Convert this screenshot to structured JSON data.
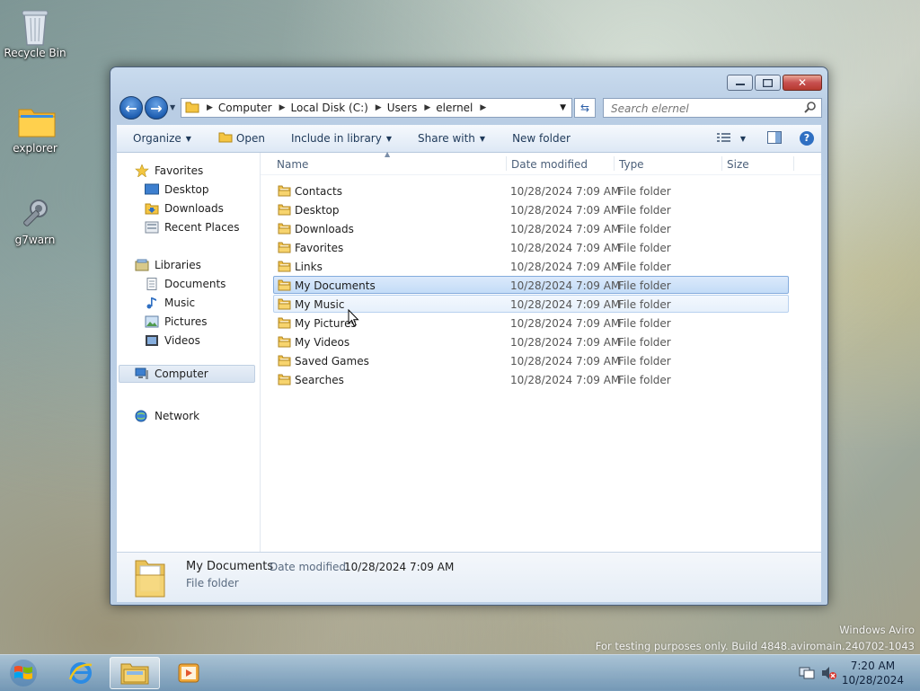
{
  "desktop": {
    "icons": [
      {
        "label": "Recycle Bin",
        "icon": "recycle-bin-icon"
      },
      {
        "label": "explorer",
        "icon": "folder-icon"
      },
      {
        "label": "g7warn",
        "icon": "gear-icon"
      }
    ],
    "watermark": {
      "line1": "Windows Aviro",
      "line2": "For testing purposes only. Build 4848.aviromain.240702-1043"
    }
  },
  "window": {
    "nav": {
      "back": "back-arrow-icon",
      "forward": "forward-arrow-icon"
    },
    "address": {
      "crumbs": [
        "Computer",
        "Local Disk (C:)",
        "Users",
        "elernel"
      ]
    },
    "search": {
      "placeholder": "Search elernel"
    },
    "toolbar": {
      "organize": "Organize",
      "open": "Open",
      "include_in_library": "Include in library",
      "share_with": "Share with",
      "new_folder": "New folder"
    },
    "sidebar": {
      "favorites": "Favorites",
      "favorites_items": [
        "Desktop",
        "Downloads",
        "Recent Places"
      ],
      "libraries": "Libraries",
      "libraries_items": [
        "Documents",
        "Music",
        "Pictures",
        "Videos"
      ],
      "computer": "Computer",
      "network": "Network"
    },
    "columns": {
      "name": "Name",
      "date": "Date modified",
      "type": "Type",
      "size": "Size"
    },
    "files": [
      {
        "name": "Contacts",
        "date": "10/28/2024 7:09 AM",
        "type": "File folder"
      },
      {
        "name": "Desktop",
        "date": "10/28/2024 7:09 AM",
        "type": "File folder"
      },
      {
        "name": "Downloads",
        "date": "10/28/2024 7:09 AM",
        "type": "File folder"
      },
      {
        "name": "Favorites",
        "date": "10/28/2024 7:09 AM",
        "type": "File folder"
      },
      {
        "name": "Links",
        "date": "10/28/2024 7:09 AM",
        "type": "File folder"
      },
      {
        "name": "My Documents",
        "date": "10/28/2024 7:09 AM",
        "type": "File folder"
      },
      {
        "name": "My Music",
        "date": "10/28/2024 7:09 AM",
        "type": "File folder"
      },
      {
        "name": "My Pictures",
        "date": "10/28/2024 7:09 AM",
        "type": "File folder"
      },
      {
        "name": "My Videos",
        "date": "10/28/2024 7:09 AM",
        "type": "File folder"
      },
      {
        "name": "Saved Games",
        "date": "10/28/2024 7:09 AM",
        "type": "File folder"
      },
      {
        "name": "Searches",
        "date": "10/28/2024 7:09 AM",
        "type": "File folder"
      }
    ],
    "details": {
      "name": "My Documents",
      "date_label": "Date modified:",
      "date_value": "10/28/2024 7:09 AM",
      "type": "File folder"
    }
  },
  "taskbar": {
    "time": "7:20 AM",
    "date": "10/28/2024"
  },
  "colors": {
    "accent": "#3a7bd5",
    "selection": "#c3dcf7"
  }
}
